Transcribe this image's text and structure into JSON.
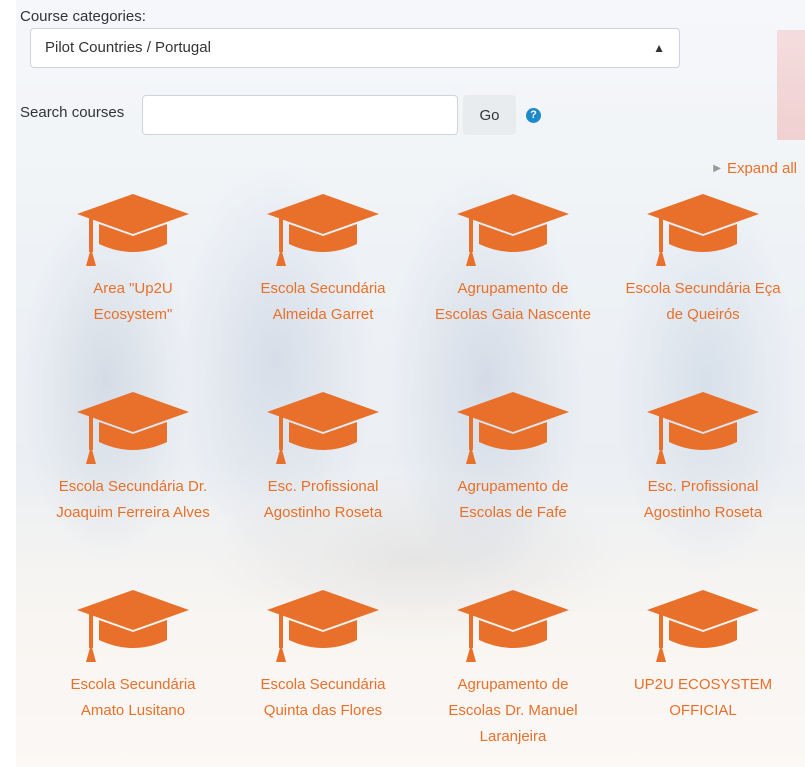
{
  "filters": {
    "category_label": "Course categories:",
    "category_selected": "Pilot Countries / Portugal",
    "search_label": "Search courses",
    "search_value": "",
    "go_label": "Go",
    "help_icon": "question-circle-icon"
  },
  "expand_all": "Expand all",
  "accent_color": "#e8702a",
  "categories": [
    {
      "name": "Area \"Up2U Ecosystem\"",
      "icon": "graduation-cap-icon"
    },
    {
      "name": "Escola Secundária Almeida Garret",
      "icon": "graduation-cap-icon"
    },
    {
      "name": "Agrupamento de Escolas Gaia Nascente",
      "icon": "graduation-cap-icon"
    },
    {
      "name": "Escola Secundária Eça de Queirós",
      "icon": "graduation-cap-icon"
    },
    {
      "name": "Escola Secundária Dr. Joaquim Ferreira Alves",
      "icon": "graduation-cap-icon"
    },
    {
      "name": "Esc. Profissional Agostinho Roseta",
      "icon": "graduation-cap-icon"
    },
    {
      "name": "Agrupamento de Escolas de Fafe",
      "icon": "graduation-cap-icon"
    },
    {
      "name": "Esc. Profissional Agostinho Roseta",
      "icon": "graduation-cap-icon"
    },
    {
      "name": "Escola Secundária Amato Lusitano",
      "icon": "graduation-cap-icon"
    },
    {
      "name": "Escola Secundária Quinta das Flores",
      "icon": "graduation-cap-icon"
    },
    {
      "name": "Agrupamento de Escolas Dr. Manuel Laranjeira",
      "icon": "graduation-cap-icon"
    },
    {
      "name": "UP2U ECOSYSTEM OFFICIAL",
      "icon": "graduation-cap-icon"
    }
  ]
}
